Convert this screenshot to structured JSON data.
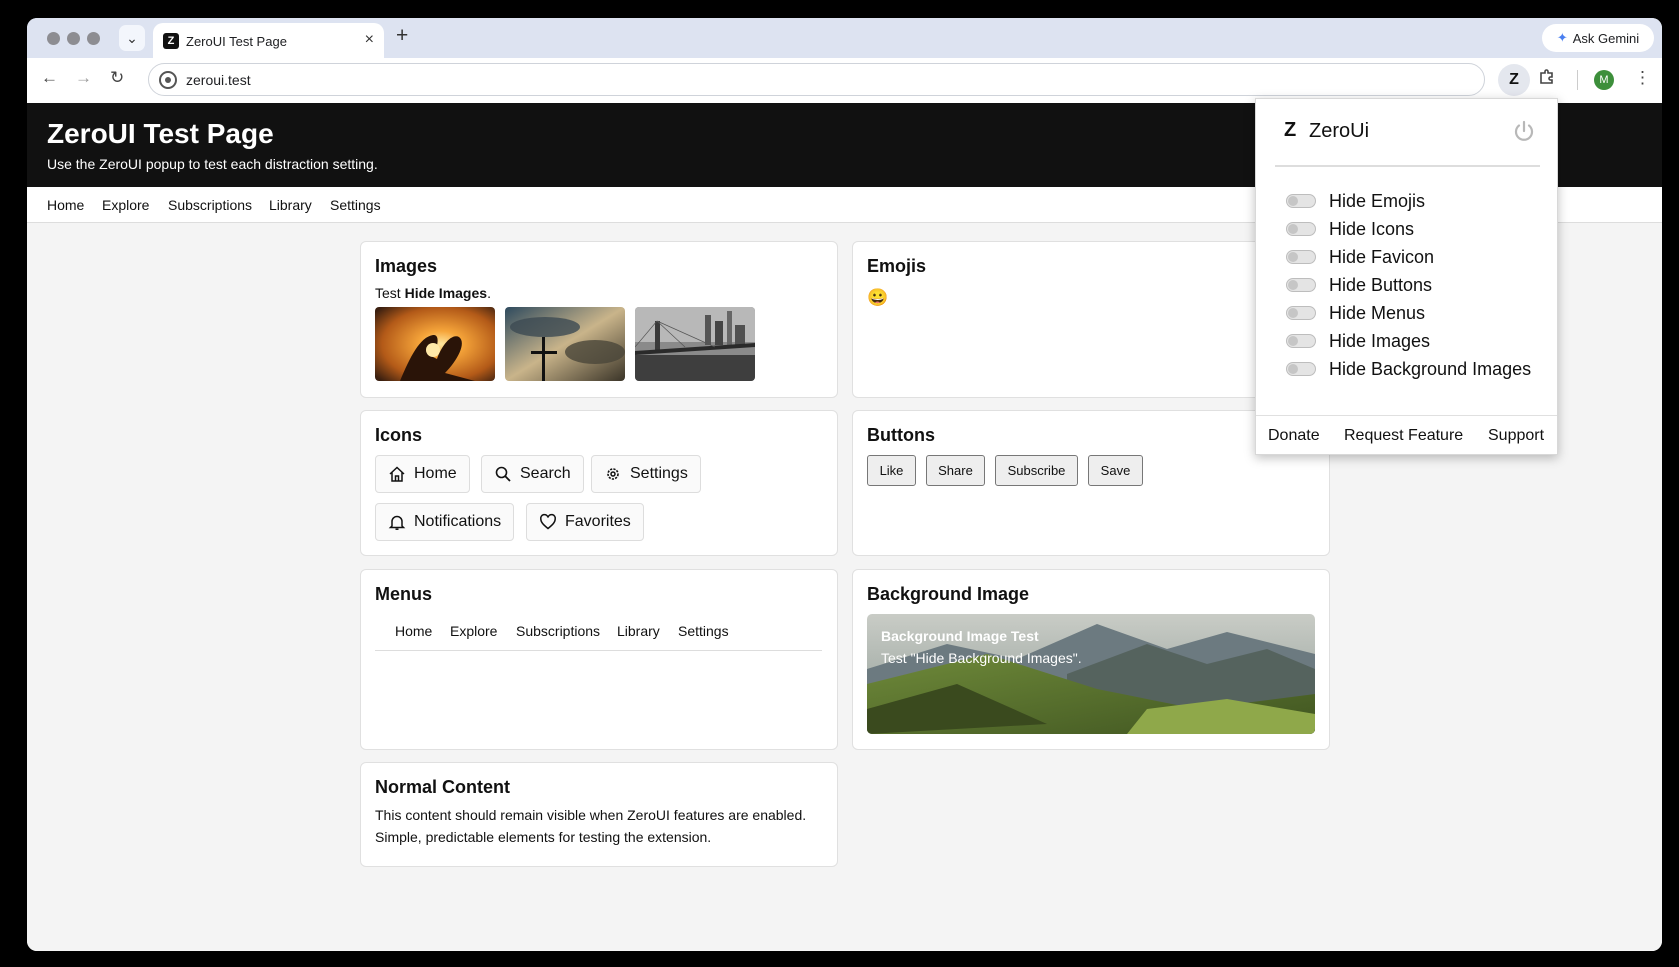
{
  "browser": {
    "tab_title": "ZeroUI Test Page",
    "tab_favicon": "Z",
    "tab_close": "×",
    "new_tab": "+",
    "tab_list": "⌄",
    "ask_gemini": "Ask Gemini",
    "url": "zeroui.test",
    "extension_label": "Z",
    "avatar_letter": "M"
  },
  "site": {
    "title": "ZeroUI Test Page",
    "subtitle": "Use the ZeroUI popup to test each distraction setting.",
    "nav": [
      "Home",
      "Explore",
      "Subscriptions",
      "Library",
      "Settings"
    ]
  },
  "cards": {
    "images": {
      "title": "Images",
      "text_prefix": "Test ",
      "text_bold": "Hide Images",
      "text_suffix": "."
    },
    "emojis": {
      "title": "Emojis",
      "emoji": "😀"
    },
    "icons": {
      "title": "Icons",
      "buttons": [
        "Home",
        "Search",
        "Settings",
        "Notifications",
        "Favorites"
      ]
    },
    "buttons": {
      "title": "Buttons",
      "buttons": [
        "Like",
        "Share",
        "Subscribe",
        "Save"
      ]
    },
    "menus": {
      "title": "Menus",
      "items": [
        "Home",
        "Explore",
        "Subscriptions",
        "Library",
        "Settings"
      ]
    },
    "background": {
      "title": "Background Image",
      "overlay_title": "Background Image Test",
      "overlay_text": "Test \"Hide Background Images\"."
    },
    "normal": {
      "title": "Normal Content",
      "line1": "This content should remain visible when ZeroUI features are enabled.",
      "line2": "Simple, predictable elements for testing the extension."
    }
  },
  "popup": {
    "logo": "Z",
    "title": "ZeroUi",
    "toggles": [
      "Hide Emojis",
      "Hide Icons",
      "Hide Favicon",
      "Hide Buttons",
      "Hide Menus",
      "Hide Images",
      "Hide Background Images"
    ],
    "toggle_states": [
      false,
      false,
      false,
      false,
      false,
      false,
      false
    ],
    "footer": [
      "Donate",
      "Request Feature",
      "Support"
    ]
  }
}
